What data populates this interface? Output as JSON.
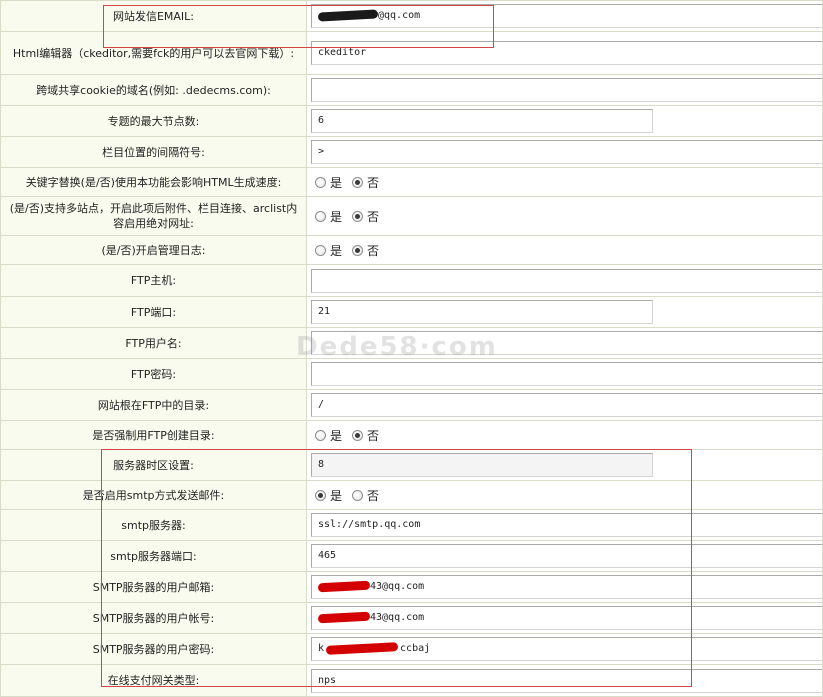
{
  "rows": [
    {
      "label": "网站发信EMAIL:",
      "type": "text",
      "value_suffix": "@qq.com",
      "redaction": "dark"
    },
    {
      "label": "Html编辑器（ckeditor,需要fck的用户可以去官网下载）:",
      "type": "text",
      "value": "ckeditor"
    },
    {
      "label": "跨域共享cookie的域名(例如: .dedecms.com):",
      "type": "text",
      "value": ""
    },
    {
      "label": "专题的最大节点数:",
      "type": "text",
      "value": "6"
    },
    {
      "label": "栏目位置的间隔符号:",
      "type": "text",
      "value": ">"
    },
    {
      "label": "关键字替换(是/否)使用本功能会影响HTML生成速度:",
      "type": "radio",
      "selected": "否"
    },
    {
      "label": "(是/否)支持多站点，开启此项后附件、栏目连接、arclist内容启用绝对网址:",
      "type": "radio",
      "selected": "否"
    },
    {
      "label": "(是/否)开启管理日志:",
      "type": "radio",
      "selected": "否"
    },
    {
      "label": "FTP主机:",
      "type": "text",
      "value": ""
    },
    {
      "label": "FTP端口:",
      "type": "text",
      "value": "21"
    },
    {
      "label": "FTP用户名:",
      "type": "text",
      "value": ""
    },
    {
      "label": "FTP密码:",
      "type": "text",
      "value": ""
    },
    {
      "label": "网站根在FTP中的目录:",
      "type": "text",
      "value": "/"
    },
    {
      "label": "是否强制用FTP创建目录:",
      "type": "radio",
      "selected": "否"
    },
    {
      "label": "服务器时区设置:",
      "type": "text",
      "value": "8"
    },
    {
      "label": "是否启用smtp方式发送邮件:",
      "type": "radio",
      "selected": "是"
    },
    {
      "label": "smtp服务器:",
      "type": "text",
      "value": "ssl://smtp.qq.com"
    },
    {
      "label": "smtp服务器端口:",
      "type": "text",
      "value": "465"
    },
    {
      "label": "SMTP服务器的用户邮箱:",
      "type": "text",
      "value_suffix": "43@qq.com",
      "redaction": "red"
    },
    {
      "label": "SMTP服务器的用户帐号:",
      "type": "text",
      "value_suffix": "43@qq.com",
      "redaction": "red"
    },
    {
      "label": "SMTP服务器的用户密码:",
      "type": "text",
      "value_prefix": "k",
      "value_suffix": "ccbaj",
      "redaction": "red"
    },
    {
      "label": "在线支付网关类型:",
      "type": "text",
      "value": "nps"
    }
  ],
  "radio_options": {
    "yes": "是",
    "no": "否"
  },
  "watermark": "Dede58·com",
  "colors": {
    "label_bg": "#f9fbef",
    "border": "#d9dcc9",
    "highlight": "#d24545",
    "redaction": "#d40000"
  }
}
